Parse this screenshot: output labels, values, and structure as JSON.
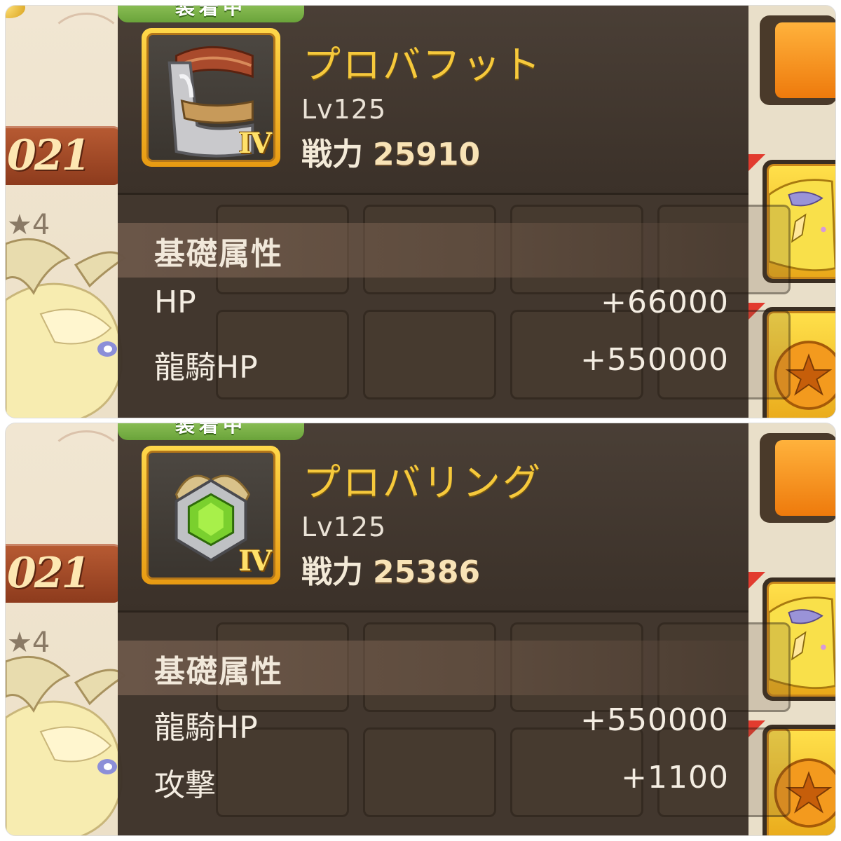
{
  "background": {
    "year_text": "021",
    "star_count_text": "★4"
  },
  "colors": {
    "equipped_tag": "#7ab94a",
    "item_name": "#f6c93c",
    "tooltip_bg": "#3a3028",
    "icon_frame": "#f0b22a"
  },
  "panels": [
    {
      "equipped_label": "装着中",
      "item_name": "プロバフット",
      "item_icon": "boot-armor-icon",
      "tier": "IV",
      "level": "Lv125",
      "power_label": "戦力",
      "power_value": "25910",
      "section_title": "基礎属性",
      "stats": [
        {
          "label": "HP",
          "value": "+66000"
        },
        {
          "label": "龍騎HP",
          "value": "+550000"
        }
      ]
    },
    {
      "equipped_label": "装着中",
      "item_name": "プロバリング",
      "item_icon": "green-gem-ring-icon",
      "tier": "IV",
      "level": "Lv125",
      "power_label": "戦力",
      "power_value": "25386",
      "section_title": "基礎属性",
      "stats": [
        {
          "label": "龍騎HP",
          "value": "+550000"
        },
        {
          "label": "攻撃",
          "value": "+1100"
        }
      ]
    }
  ]
}
